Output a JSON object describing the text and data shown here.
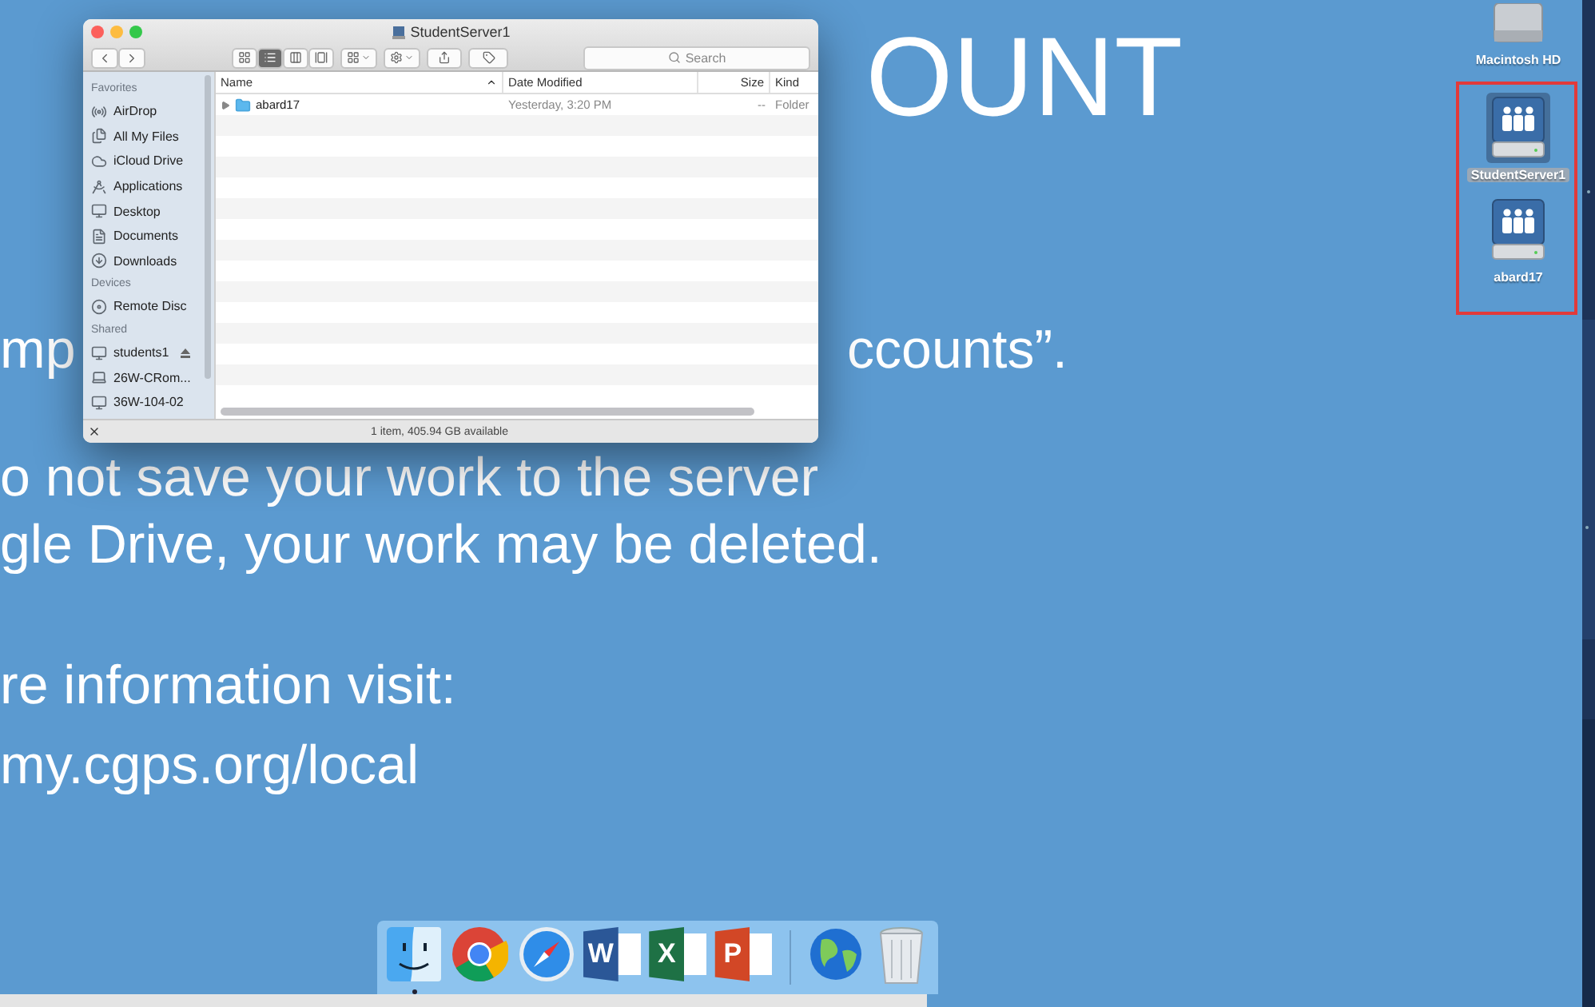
{
  "slide": {
    "lines": [
      {
        "kind": "title",
        "right": "OUNT"
      },
      {
        "kind": "body",
        "left": "mp",
        "right": "ccounts”."
      },
      {
        "kind": "body",
        "left": "o not save your work to the server"
      },
      {
        "kind": "body",
        "left": "gle Drive, your work may be deleted."
      },
      {
        "kind": "body",
        "left": "re information visit:"
      },
      {
        "kind": "body",
        "left": "my.cgps.org/local"
      }
    ]
  },
  "finder": {
    "title": "StudentServer1",
    "views": [
      {
        "selected": false
      },
      {
        "selected": true
      },
      {
        "selected": false
      },
      {
        "selected": false
      }
    ],
    "search": {
      "placeholder": "Search"
    },
    "sidebar": [
      {
        "heading": "Favorites",
        "items": [
          {
            "label": "AirDrop",
            "kind": "airdrop",
            "eject": false
          },
          {
            "label": "All My Files",
            "kind": "files",
            "eject": false
          },
          {
            "label": "iCloud Drive",
            "kind": "cloud",
            "eject": false
          },
          {
            "label": "Applications",
            "kind": "apps",
            "eject": false
          },
          {
            "label": "Desktop",
            "kind": "desktop",
            "eject": false
          },
          {
            "label": "Documents",
            "kind": "documents",
            "eject": false
          },
          {
            "label": "Downloads",
            "kind": "downloads",
            "eject": false
          }
        ]
      },
      {
        "heading": "Devices",
        "items": [
          {
            "label": "Remote Disc",
            "kind": "disc",
            "eject": false
          }
        ]
      },
      {
        "heading": "Shared",
        "items": [
          {
            "label": "students1",
            "kind": "server",
            "eject": true
          },
          {
            "label": "26W-CRom...",
            "kind": "laptop",
            "eject": false
          },
          {
            "label": "36W-104-02",
            "kind": "server",
            "eject": false
          }
        ]
      }
    ],
    "columns": [
      "Name",
      "Date Modified",
      "Size",
      "Kind"
    ],
    "rows": [
      {
        "name": "abard17",
        "date": "Yesterday, 3:20 PM",
        "size": "--",
        "kind": "Folder",
        "expanded": false
      }
    ],
    "status": "1 item, 405.94 GB available"
  },
  "desktop_icons": [
    {
      "label": "Macintosh HD",
      "kind": "drive",
      "selected": false
    },
    {
      "label": "StudentServer1",
      "kind": "server",
      "selected": true
    },
    {
      "label": "abard17",
      "kind": "server",
      "selected": false
    }
  ],
  "dock": [
    {
      "kind": "finder",
      "running": true
    },
    {
      "kind": "chrome",
      "running": false
    },
    {
      "kind": "safari",
      "running": false
    },
    {
      "kind": "word",
      "glyph": "W",
      "running": false
    },
    {
      "kind": "excel",
      "glyph": "X",
      "running": false
    },
    {
      "kind": "powerpoint",
      "glyph": "P",
      "running": false
    },
    {
      "kind": "separator"
    },
    {
      "kind": "globe",
      "running": false
    },
    {
      "kind": "trash",
      "running": false
    }
  ]
}
